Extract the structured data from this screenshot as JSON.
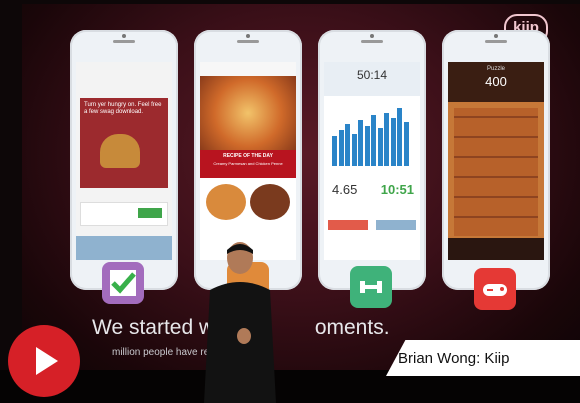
{
  "slide": {
    "logo_text": "kiip",
    "caption": "We started wi",
    "caption_tail": "oments.",
    "subcaption": "million people have rec"
  },
  "phones": [
    {
      "name": "food-ad",
      "headline": "Turn yer hungry on. Feel free a few swag download.",
      "icon_color": "#a36cbd"
    },
    {
      "name": "recipes",
      "headline": "RECIPE OF THE DAY",
      "sub": "Creamy Parmesan and Chicken Penne",
      "icon_color": "#e08a3a"
    },
    {
      "name": "fitness",
      "time": "50:14",
      "stat_left": "4.65",
      "stat_right": "10:51",
      "icon_color": "#3fb27a"
    },
    {
      "name": "puzzle",
      "title": "Puzzle",
      "number": "400",
      "icon_color": "#e53935"
    }
  ],
  "fitness_bars": [
    28,
    34,
    40,
    30,
    44,
    38,
    48,
    36,
    50,
    46,
    55,
    42
  ],
  "banner": {
    "text": "Brian Wong: Kiip"
  },
  "colors": {
    "accent": "#d62027",
    "banner": "#ffffff"
  }
}
